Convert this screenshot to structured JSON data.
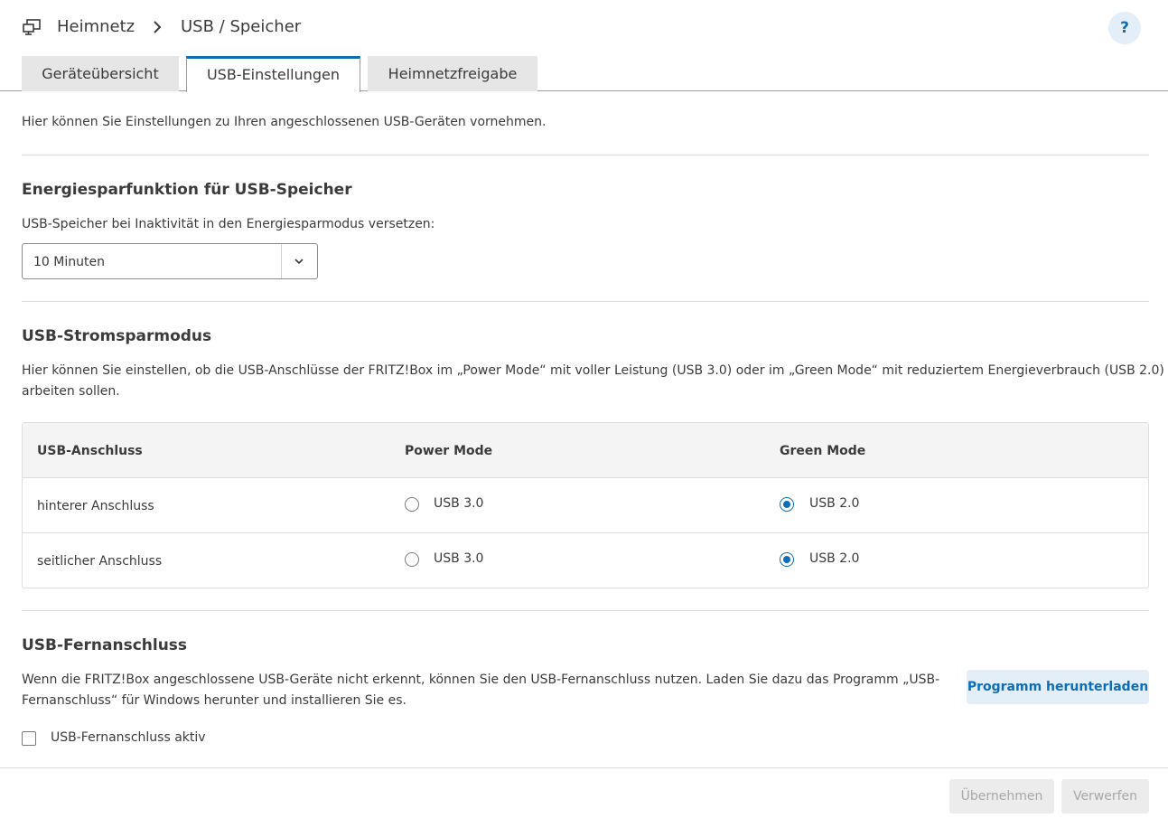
{
  "header": {
    "breadcrumb": [
      "Heimnetz",
      "USB / Speicher"
    ],
    "help_label": "?"
  },
  "tabs": [
    {
      "label": "Geräteübersicht",
      "active": false
    },
    {
      "label": "USB-Einstellungen",
      "active": true
    },
    {
      "label": "Heimnetzfreigabe",
      "active": false
    }
  ],
  "intro": "Hier können Sie Einstellungen zu Ihren angeschlossenen USB-Geräten vornehmen.",
  "energy": {
    "title": "Energiesparfunktion für USB-Speicher",
    "label": "USB-Speicher bei Inaktivität in den Energiesparmodus versetzen:",
    "selected": "10 Minuten"
  },
  "powermode": {
    "title": "USB-Stromsparmodus",
    "desc_line1": "Hier können Sie einstellen, ob die USB-Anschlüsse der FRITZ!Box im „Power Mode“ mit voller Leistung (USB 3.0) oder im „Green Mode“ mit reduziertem Energieverbrauch (USB 2.0)",
    "desc_line2": "arbeiten sollen.",
    "columns": [
      "USB-Anschluss",
      "Power Mode",
      "Green Mode"
    ],
    "rows": [
      {
        "port": "hinterer Anschluss",
        "power": "USB 3.0",
        "green": "USB 2.0",
        "selected": "green"
      },
      {
        "port": "seitlicher Anschluss",
        "power": "USB 3.0",
        "green": "USB 2.0",
        "selected": "green"
      }
    ]
  },
  "remote": {
    "title": "USB-Fernanschluss",
    "desc_line1": "Wenn die FRITZ!Box angeschlossene USB-Geräte nicht erkennt, können Sie den USB-Fernanschluss nutzen. Laden Sie dazu das Programm „USB-",
    "desc_line2": "Fernanschluss“ für Windows herunter und installieren Sie es.",
    "download_label": "Programm herunterladen",
    "checkbox_label": "USB-Fernanschluss aktiv",
    "checkbox_checked": false
  },
  "footer": {
    "apply_label": "Übernehmen",
    "discard_label": "Verwerfen"
  },
  "colors": {
    "accent": "#0e6db8",
    "accent_light": "#e3eef8"
  }
}
